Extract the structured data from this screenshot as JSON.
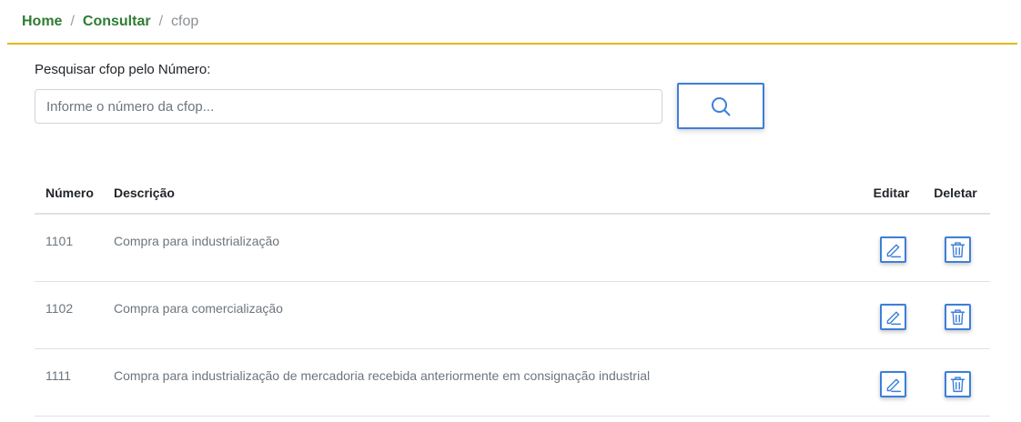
{
  "breadcrumb": {
    "home": "Home",
    "consultar": "Consultar",
    "separator": "/",
    "current": "cfop"
  },
  "search": {
    "label": "Pesquisar cfop pelo Número:",
    "placeholder": "Informe o número da cfop...",
    "value": "",
    "button_icon": "search-icon"
  },
  "table": {
    "headers": {
      "numero": "Número",
      "descricao": "Descrição",
      "editar": "Editar",
      "deletar": "Deletar"
    },
    "rows": [
      {
        "numero": "1101",
        "descricao": "Compra para industrialização",
        "edit_icon": "edit-pencil-icon",
        "delete_icon": "trash-icon"
      },
      {
        "numero": "1102",
        "descricao": "Compra para comercialização",
        "edit_icon": "edit-pencil-icon",
        "delete_icon": "trash-icon"
      },
      {
        "numero": "1111",
        "descricao": "Compra para industrialização de mercadoria recebida anteriormente em consignação industrial",
        "edit_icon": "edit-pencil-icon",
        "delete_icon": "trash-icon"
      }
    ]
  },
  "colors": {
    "breadcrumb_link": "#2e7d32",
    "header_line": "#e2b80f",
    "button_accent": "#3d7fd9"
  }
}
